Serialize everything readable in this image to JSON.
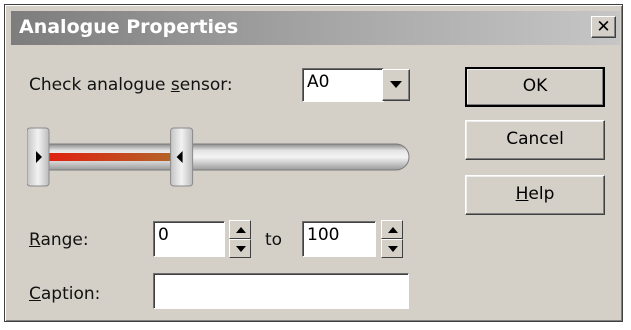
{
  "dialog": {
    "title": "Analogue Properties",
    "close_glyph": "✕"
  },
  "sensor": {
    "label_pre": "Check analogue ",
    "label_accel": "s",
    "label_post": "ensor:",
    "value": "A0"
  },
  "slider": {
    "low_fraction": 0.0,
    "high_fraction": 0.4,
    "fill_color": "#d02818"
  },
  "range": {
    "label_accel": "R",
    "label_rest": "ange:",
    "from": "0",
    "to_label": "to",
    "to": "100"
  },
  "caption": {
    "label_accel": "C",
    "label_rest": "aption:",
    "value": ""
  },
  "buttons": {
    "ok": "OK",
    "cancel": "Cancel",
    "help_accel": "H",
    "help_rest": "elp"
  },
  "icons": {
    "close": "close-icon",
    "dropdown": "chevron-down-icon",
    "spin_up": "chevron-up-icon",
    "spin_down": "chevron-down-icon"
  }
}
